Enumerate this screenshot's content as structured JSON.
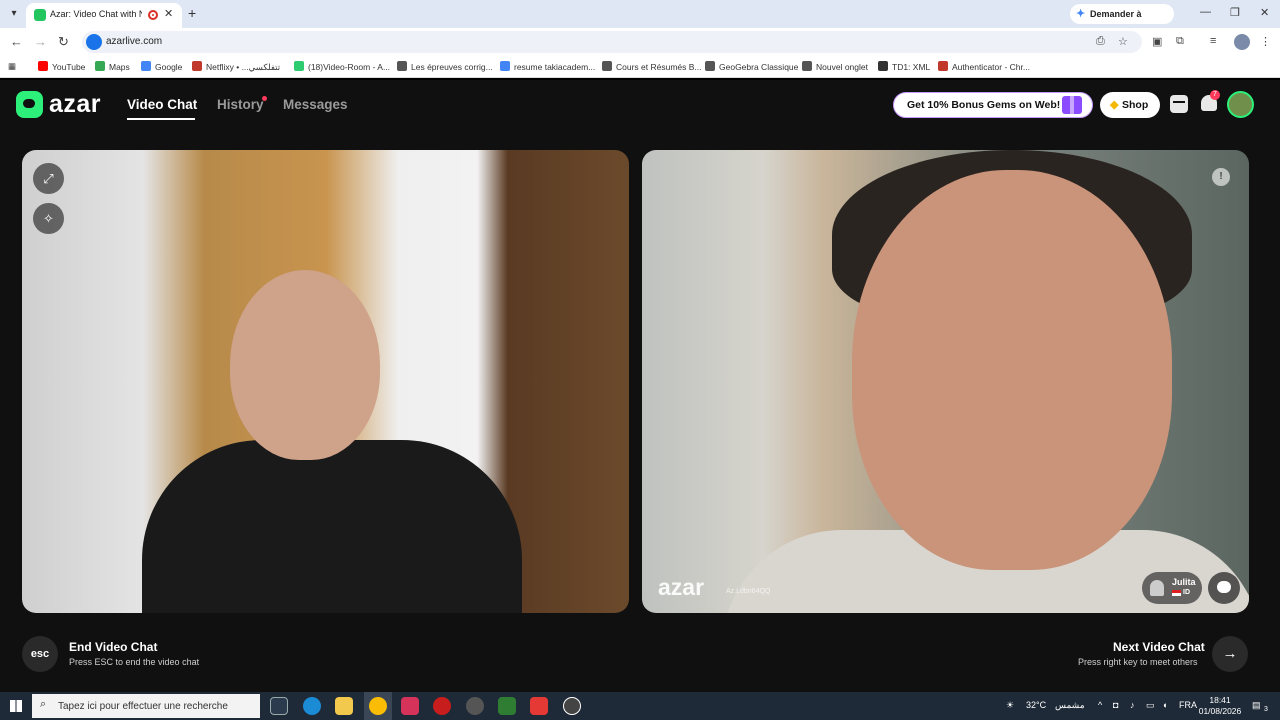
{
  "browser": {
    "tab_title": "Azar: Video Chat with New",
    "new_tab": "+",
    "gemini_label": "Demander à Gemini",
    "url": "azarlive.com",
    "bookmarks": [
      {
        "label": "YouTube",
        "color": "#ff0000"
      },
      {
        "label": "Maps",
        "color": "#34a853"
      },
      {
        "label": "Google",
        "color": "#4285f4"
      },
      {
        "label": "Netflixy • ...تتفلكسي",
        "color": "#c0392b"
      },
      {
        "label": "(18)Video-Room - A...",
        "color": "#2ecc71"
      },
      {
        "label": "Les épreuves corrig...",
        "color": "#555555"
      },
      {
        "label": "resume takiacadem...",
        "color": "#4285f4"
      },
      {
        "label": "Cours et Résumés B...",
        "color": "#555555"
      },
      {
        "label": "GeoGebra Classique",
        "color": "#555555"
      },
      {
        "label": "Nouvel onglet",
        "color": "#555555"
      },
      {
        "label": "TD1: XML",
        "color": "#333333"
      },
      {
        "label": "Authenticator - Chr...",
        "color": "#c0392b"
      }
    ]
  },
  "app": {
    "logo": "azar",
    "nav": {
      "video_chat": "Video Chat",
      "history": "History",
      "messages": "Messages"
    },
    "bonus_label": "Get 10% Bonus Gems on Web!",
    "shop_label": "Shop",
    "notification_count": "7",
    "partner": {
      "name": "Julita",
      "country": "ID",
      "watermark_id": "Az.Ldbn64QQ"
    },
    "watermark_logo": "azar",
    "report_glyph": "!",
    "end_chat": {
      "key": "esc",
      "title": "End Video Chat",
      "subtitle": "Press ESC to end the video chat"
    },
    "next_chat": {
      "title": "Next Video Chat",
      "subtitle": "Press right key to meet others",
      "arrow": "→"
    }
  },
  "taskbar": {
    "search_placeholder": "Tapez ici pour effectuer une recherche",
    "weather": "32°C",
    "weather_desc": "مشمس",
    "lang": "FRA",
    "time": "18:41",
    "date": "01/08/2026",
    "notif_count": "3"
  },
  "colors": {
    "brand": "#2cf07a",
    "badge": "#ff3b5c",
    "gift": "#8b4bff"
  }
}
